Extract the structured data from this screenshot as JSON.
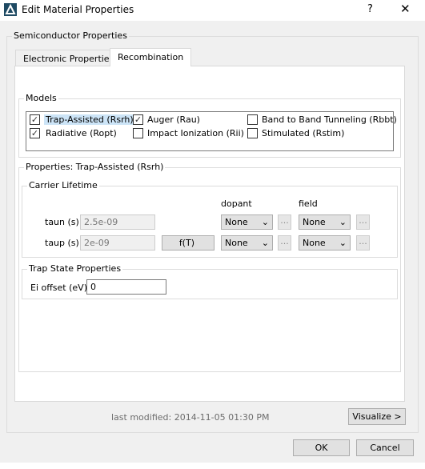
{
  "window": {
    "title": "Edit Material Properties",
    "help": "?",
    "close": "✕",
    "brand_color": "#1e4a63"
  },
  "semiconductor": {
    "label": "Semiconductor Properties",
    "tabs": [
      {
        "label": "Electronic Properties"
      },
      {
        "label": "Recombination"
      }
    ],
    "models": {
      "label": "Models",
      "items": [
        {
          "label": "Trap-Assisted (Rsrh)",
          "checked": true
        },
        {
          "label": "Auger (Rau)",
          "checked": true
        },
        {
          "label": "Band to Band Tunneling (Rbbt)",
          "checked": false
        },
        {
          "label": "Radiative (Ropt)",
          "checked": true
        },
        {
          "label": "Impact Ionization (Rii)",
          "checked": false
        },
        {
          "label": "Stimulated (Rstim)",
          "checked": false
        }
      ]
    },
    "properties": {
      "label": "Properties: Trap-Assisted (Rsrh)",
      "carrier": {
        "label": "Carrier Lifetime",
        "dopant_header": "dopant",
        "field_header": "field",
        "rows": [
          {
            "label": "taun (s)",
            "value": "2.5e-09",
            "dopant": "None",
            "field": "None",
            "more": "..."
          },
          {
            "label": "taup (s)",
            "value": "2e-09",
            "ft": "f(T)",
            "dopant": "None",
            "field": "None",
            "more": "..."
          }
        ]
      },
      "trap": {
        "label": "Trap State Properties",
        "ei_label": "Ei offset (eV)",
        "ei_value": "0"
      }
    },
    "last_modified": "last modified: 2014-11-05 01:30 PM",
    "visualize": "Visualize >"
  },
  "footer": {
    "ok": "OK",
    "cancel": "Cancel"
  }
}
